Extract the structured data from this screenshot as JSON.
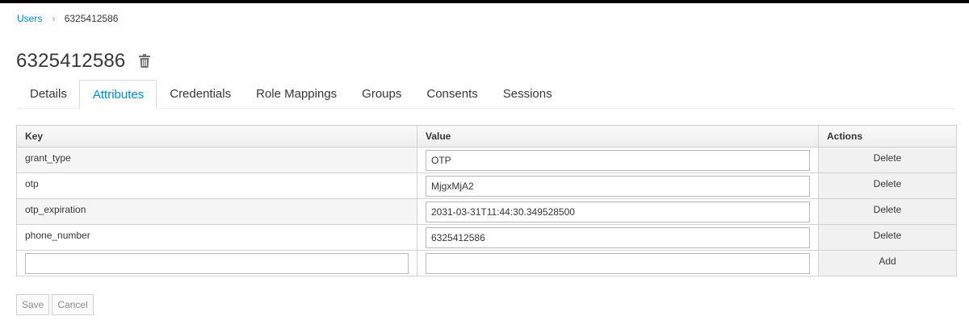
{
  "breadcrumb": {
    "parent": "Users",
    "separator": "›",
    "current": "6325412586"
  },
  "page": {
    "title": "6325412586"
  },
  "tabs": [
    {
      "label": "Details"
    },
    {
      "label": "Attributes"
    },
    {
      "label": "Credentials"
    },
    {
      "label": "Role Mappings"
    },
    {
      "label": "Groups"
    },
    {
      "label": "Consents"
    },
    {
      "label": "Sessions"
    }
  ],
  "active_tab": "Attributes",
  "table": {
    "headers": {
      "key": "Key",
      "value": "Value",
      "actions": "Actions"
    },
    "rows": [
      {
        "key": "grant_type",
        "value": "OTP",
        "action": "Delete"
      },
      {
        "key": "otp",
        "value": "MjgxMjA2",
        "action": "Delete"
      },
      {
        "key": "otp_expiration",
        "value": "2031-03-31T11:44:30.349528500",
        "action": "Delete"
      },
      {
        "key": "phone_number",
        "value": "6325412586",
        "action": "Delete"
      }
    ],
    "new_row": {
      "key": "",
      "value": "",
      "action": "Add"
    }
  },
  "buttons": {
    "save": "Save",
    "cancel": "Cancel"
  },
  "colors": {
    "link": "#0088ce",
    "text": "#363636",
    "border": "#d1d1d1"
  },
  "icons": {
    "delete_user": "trash-icon",
    "breadcrumb_sep": "chevron-right-icon"
  }
}
